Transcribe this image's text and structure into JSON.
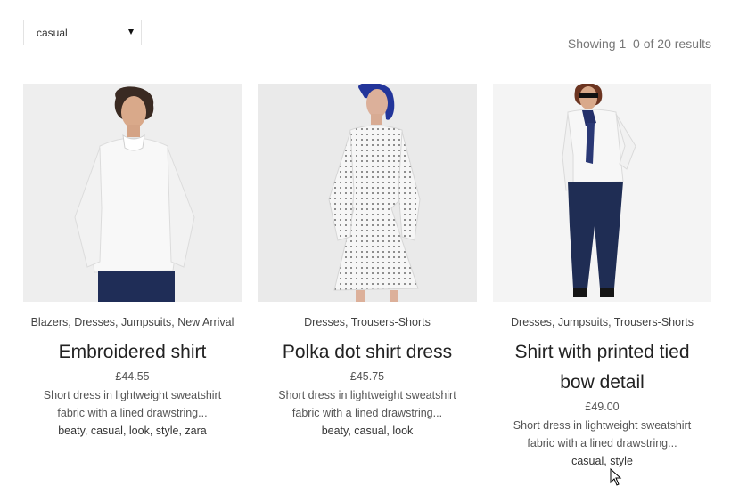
{
  "toolbar": {
    "orderby_value": "casual",
    "results_text": "Showing 1–0 of 20 results"
  },
  "products": [
    {
      "categories": "Blazers, Dresses, Jumpsuits, New Arrival",
      "title": "Embroidered shirt",
      "price": "£44.55",
      "description": "Short dress in lightweight sweatshirt fabric with a lined drawstring...",
      "tags": "beaty, casual, look, style, zara"
    },
    {
      "categories": "Dresses, Trousers-Shorts",
      "title": "Polka dot shirt dress",
      "price": "£45.75",
      "description": "Short dress in lightweight sweatshirt fabric with a lined drawstring...",
      "tags": "beaty, casual, look"
    },
    {
      "categories": "Dresses, Jumpsuits, Trousers-Shorts",
      "title": "Shirt with printed tied bow detail",
      "price": "£49.00",
      "description": "Short dress in lightweight sweatshirt fabric with a lined drawstring...",
      "tags": "casual, style"
    }
  ]
}
